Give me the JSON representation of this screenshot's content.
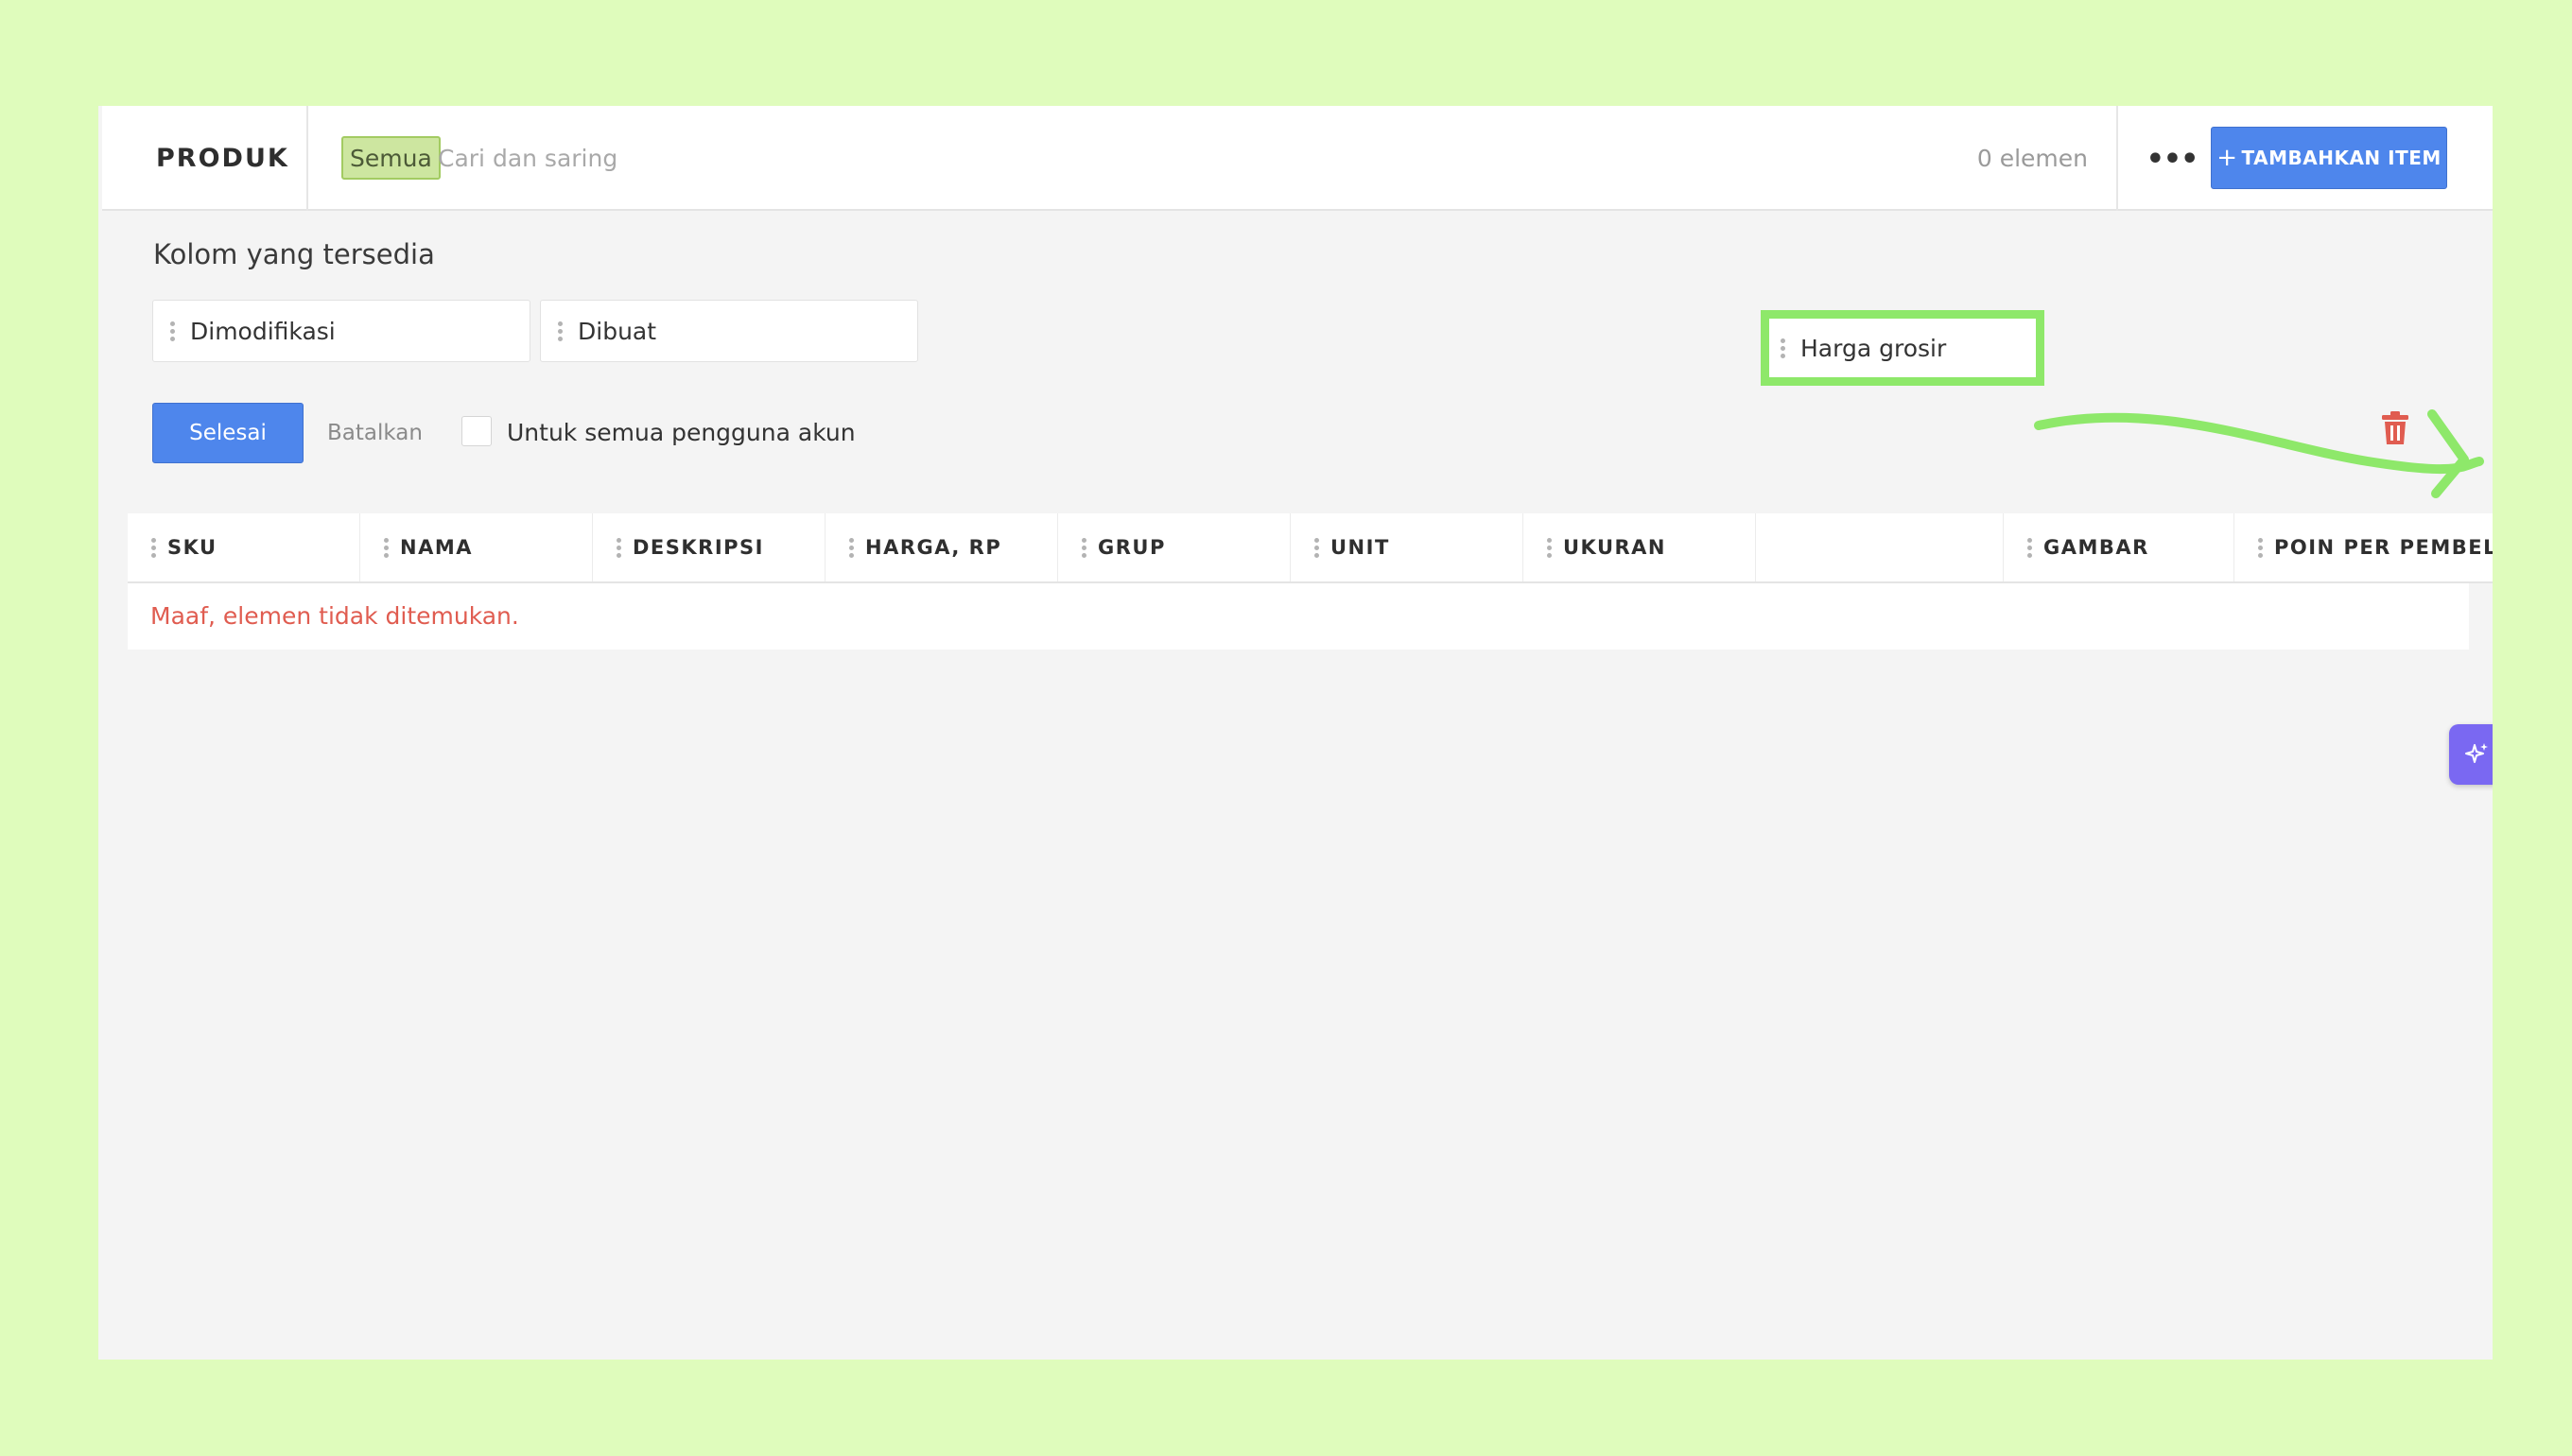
{
  "header": {
    "title": "PRODUK",
    "tag": "Semua",
    "search_placeholder": "Cari dan saring",
    "count": "0 elemen",
    "more_label": "•••",
    "add_button": "TAMBAHKAN ITEM"
  },
  "columns_panel": {
    "title": "Kolom yang tersedia",
    "available": [
      "Dimodifikasi",
      "Dibuat"
    ],
    "dragging": "Harga grosir",
    "done_button": "Selesai",
    "cancel_link": "Batalkan",
    "all_users_label": "Untuk semua pengguna akun"
  },
  "table": {
    "columns": [
      "SKU",
      "NAMA",
      "DESKRIPSI",
      "HARGA, RP",
      "GRUP",
      "UNIT",
      "UKURAN",
      "",
      "GAMBAR",
      "POIN PER PEMBEL"
    ],
    "empty_message": "Maaf, elemen tidak ditemukan."
  },
  "colors": {
    "background": "#dffcbc",
    "primary": "#4e86ec",
    "highlight": "#8ee86a",
    "danger": "#e05c50",
    "assistant": "#7a68f2"
  },
  "icons": {
    "delete": "trash-icon",
    "assistant": "sparkle-icon",
    "more": "ellipsis-icon"
  }
}
